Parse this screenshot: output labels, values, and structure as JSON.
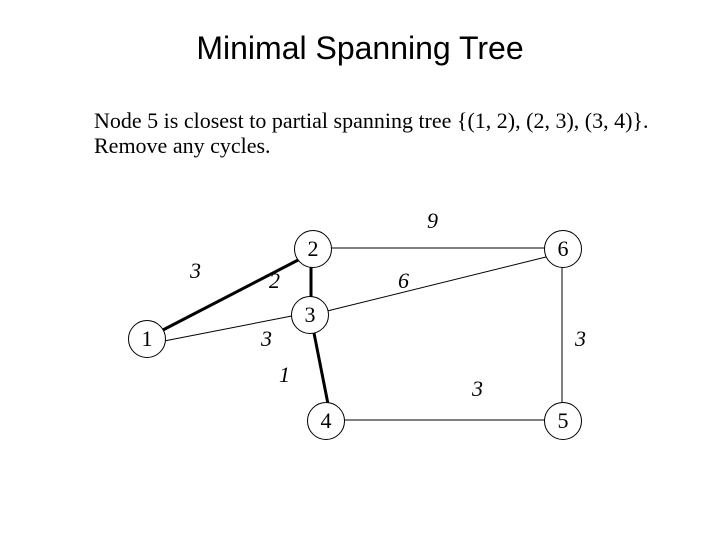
{
  "title": "Minimal Spanning Tree",
  "caption": "Node 5 is closest to partial spanning tree {(1, 2), (2, 3), (3, 4)}. Remove any cycles.",
  "nodes": {
    "n1": "1",
    "n2": "2",
    "n3": "3",
    "n4": "4",
    "n5": "5",
    "n6": "6"
  },
  "edge_labels": {
    "e12": "3",
    "e23": "2",
    "e26": "9",
    "e36": "6",
    "e13": "3",
    "e34": "1",
    "e45": "3",
    "e56": "3"
  },
  "chart_data": {
    "type": "graph",
    "title": "Minimal Spanning Tree",
    "nodes": [
      1,
      2,
      3,
      4,
      5,
      6
    ],
    "edges": [
      {
        "u": 1,
        "v": 2,
        "w": 3,
        "in_tree": true
      },
      {
        "u": 2,
        "v": 3,
        "w": 2,
        "in_tree": true
      },
      {
        "u": 2,
        "v": 6,
        "w": 9,
        "in_tree": false
      },
      {
        "u": 3,
        "v": 6,
        "w": 6,
        "in_tree": false
      },
      {
        "u": 1,
        "v": 3,
        "w": 3,
        "in_tree": false
      },
      {
        "u": 3,
        "v": 4,
        "w": 1,
        "in_tree": true
      },
      {
        "u": 4,
        "v": 5,
        "w": 3,
        "in_tree": false
      },
      {
        "u": 5,
        "v": 6,
        "w": 3,
        "in_tree": false
      }
    ]
  }
}
